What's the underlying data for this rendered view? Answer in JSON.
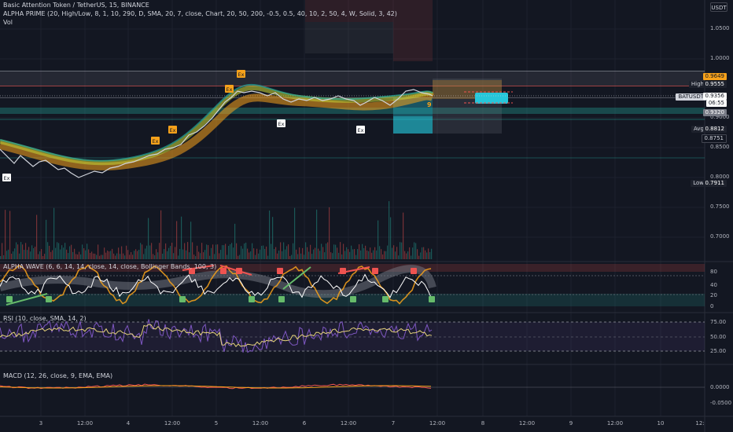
{
  "header": {
    "symbol_line": "Basic Attention Token / TetherUS, 15, BINANCE",
    "indicator_line": "ALPHA PRIME (20, High/Low, 8, 1, 10, 290, D, SMA, 20, 7, close, Chart, 20, 50, 200, -0.5, 0.5, 40, 10, 2, 50, 4, W, Solid, 3, 42)",
    "vol_label": "Vol"
  },
  "currency_button": "USDT",
  "price_axis": {
    "labels": [
      "1.0500",
      "1.0000",
      "0.9000",
      "0.8500",
      "0.8000",
      "0.7500",
      "0.7000"
    ]
  },
  "price_tags": {
    "high_label": "High",
    "high_value": "0.9555",
    "orange_value": "0.9649",
    "symbol_tag": "BATUSDT",
    "last_price": "0.9356",
    "countdown": "06:55",
    "gray_value": "0.9320",
    "avg_label": "Avg",
    "avg_value": "0.8812",
    "avg2_value": "0.8751",
    "low_label": "Low",
    "low_value": "0.7911"
  },
  "pane_alpha_wave": {
    "title": "ALPHA WAVE (6, 6, 14, 14, close, 14, close, Bollinger Bands, 100, 3)",
    "axis": [
      "80",
      "40",
      "20",
      "0"
    ]
  },
  "pane_rsi": {
    "title": "RSI (10, close, SMA, 14, 2)",
    "axis": [
      "75.00",
      "50.00",
      "25.00"
    ]
  },
  "pane_macd": {
    "title": "MACD (12, 26, close, 9, EMA, EMA)",
    "axis": [
      "0.0000",
      "-0.0500"
    ]
  },
  "time_axis": {
    "labels": [
      "3",
      "12:00",
      "4",
      "12:00",
      "5",
      "12:00",
      "6",
      "12:00",
      "7",
      "12:00",
      "8",
      "12:00",
      "9",
      "12:00",
      "10",
      "12:"
    ]
  },
  "markers": {
    "exit_label": "Ex",
    "count_label": "9",
    "long_label": "B",
    "short_label": "S"
  },
  "colors": {
    "background": "#131722",
    "grid": "#1e222d",
    "accent_orange": "#f7a21b",
    "accent_cyan": "#26c6da",
    "bull_green": "#26a69a",
    "bear_red": "#ef5350",
    "rsi_purple": "#7e57c2"
  }
}
